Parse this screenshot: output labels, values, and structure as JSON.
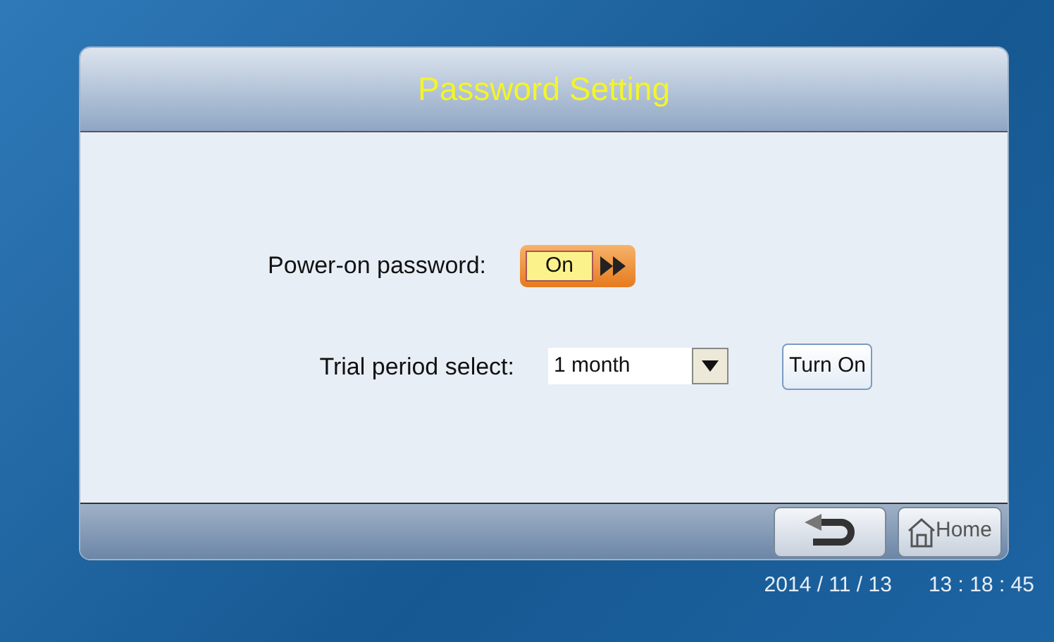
{
  "window": {
    "title": "Password Setting"
  },
  "power_on_password": {
    "label": "Power-on password:",
    "toggle": {
      "label": "On",
      "on": true
    }
  },
  "trial_period": {
    "label": "Trial period select:",
    "value": "1 month",
    "button": "Turn On"
  },
  "footer": {
    "home_label": "Home"
  },
  "status_bar": {
    "date": "2014 / 11 / 13",
    "time": "13 : 18 : 45"
  }
}
